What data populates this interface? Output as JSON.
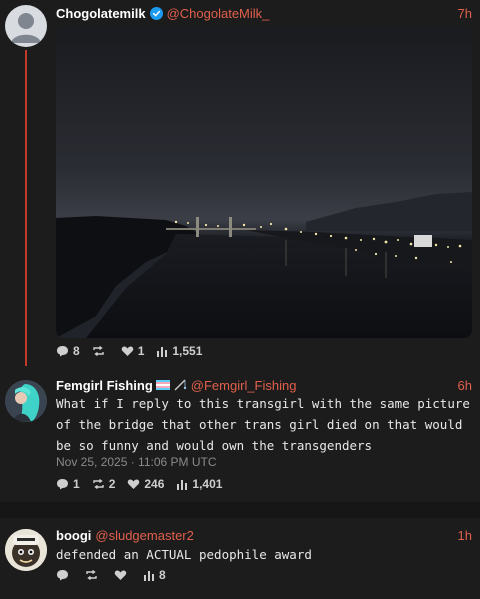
{
  "posts": [
    {
      "name": "Chogolatemilk",
      "handle": "@ChogolateMilk_",
      "time": "7h",
      "stats": {
        "replies": "8",
        "reposts": "",
        "likes": "1",
        "views": "1,551"
      }
    },
    {
      "name": "Femgirl Fishing",
      "handle": "@Femgirl_Fishing",
      "time": "6h",
      "text": "What if I reply to this transgirl with the same picture of the bridge that other trans girl died on that would be so funny and would own the transgenders",
      "date": "Nov 25, 2025 · 11:06 PM UTC",
      "stats": {
        "replies": "1",
        "reposts": "2",
        "likes": "246",
        "views": "1,401"
      }
    },
    {
      "name": "boogi",
      "handle": "@sludgemaster2",
      "time": "1h",
      "text": "defended an ACTUAL pedophile award",
      "stats": {
        "replies": "",
        "reposts": "",
        "likes": "",
        "views": "8"
      }
    }
  ],
  "colors": {
    "accent": "#e0604c",
    "thread_line": "#c0392b",
    "background": "#1c1c1c",
    "verified": "#1d9bf0"
  },
  "icons": [
    "default-avatar-icon",
    "verified-icon",
    "trans-flag-icon",
    "fishing-rod-icon",
    "reply-icon",
    "repost-icon",
    "like-icon",
    "views-icon"
  ]
}
